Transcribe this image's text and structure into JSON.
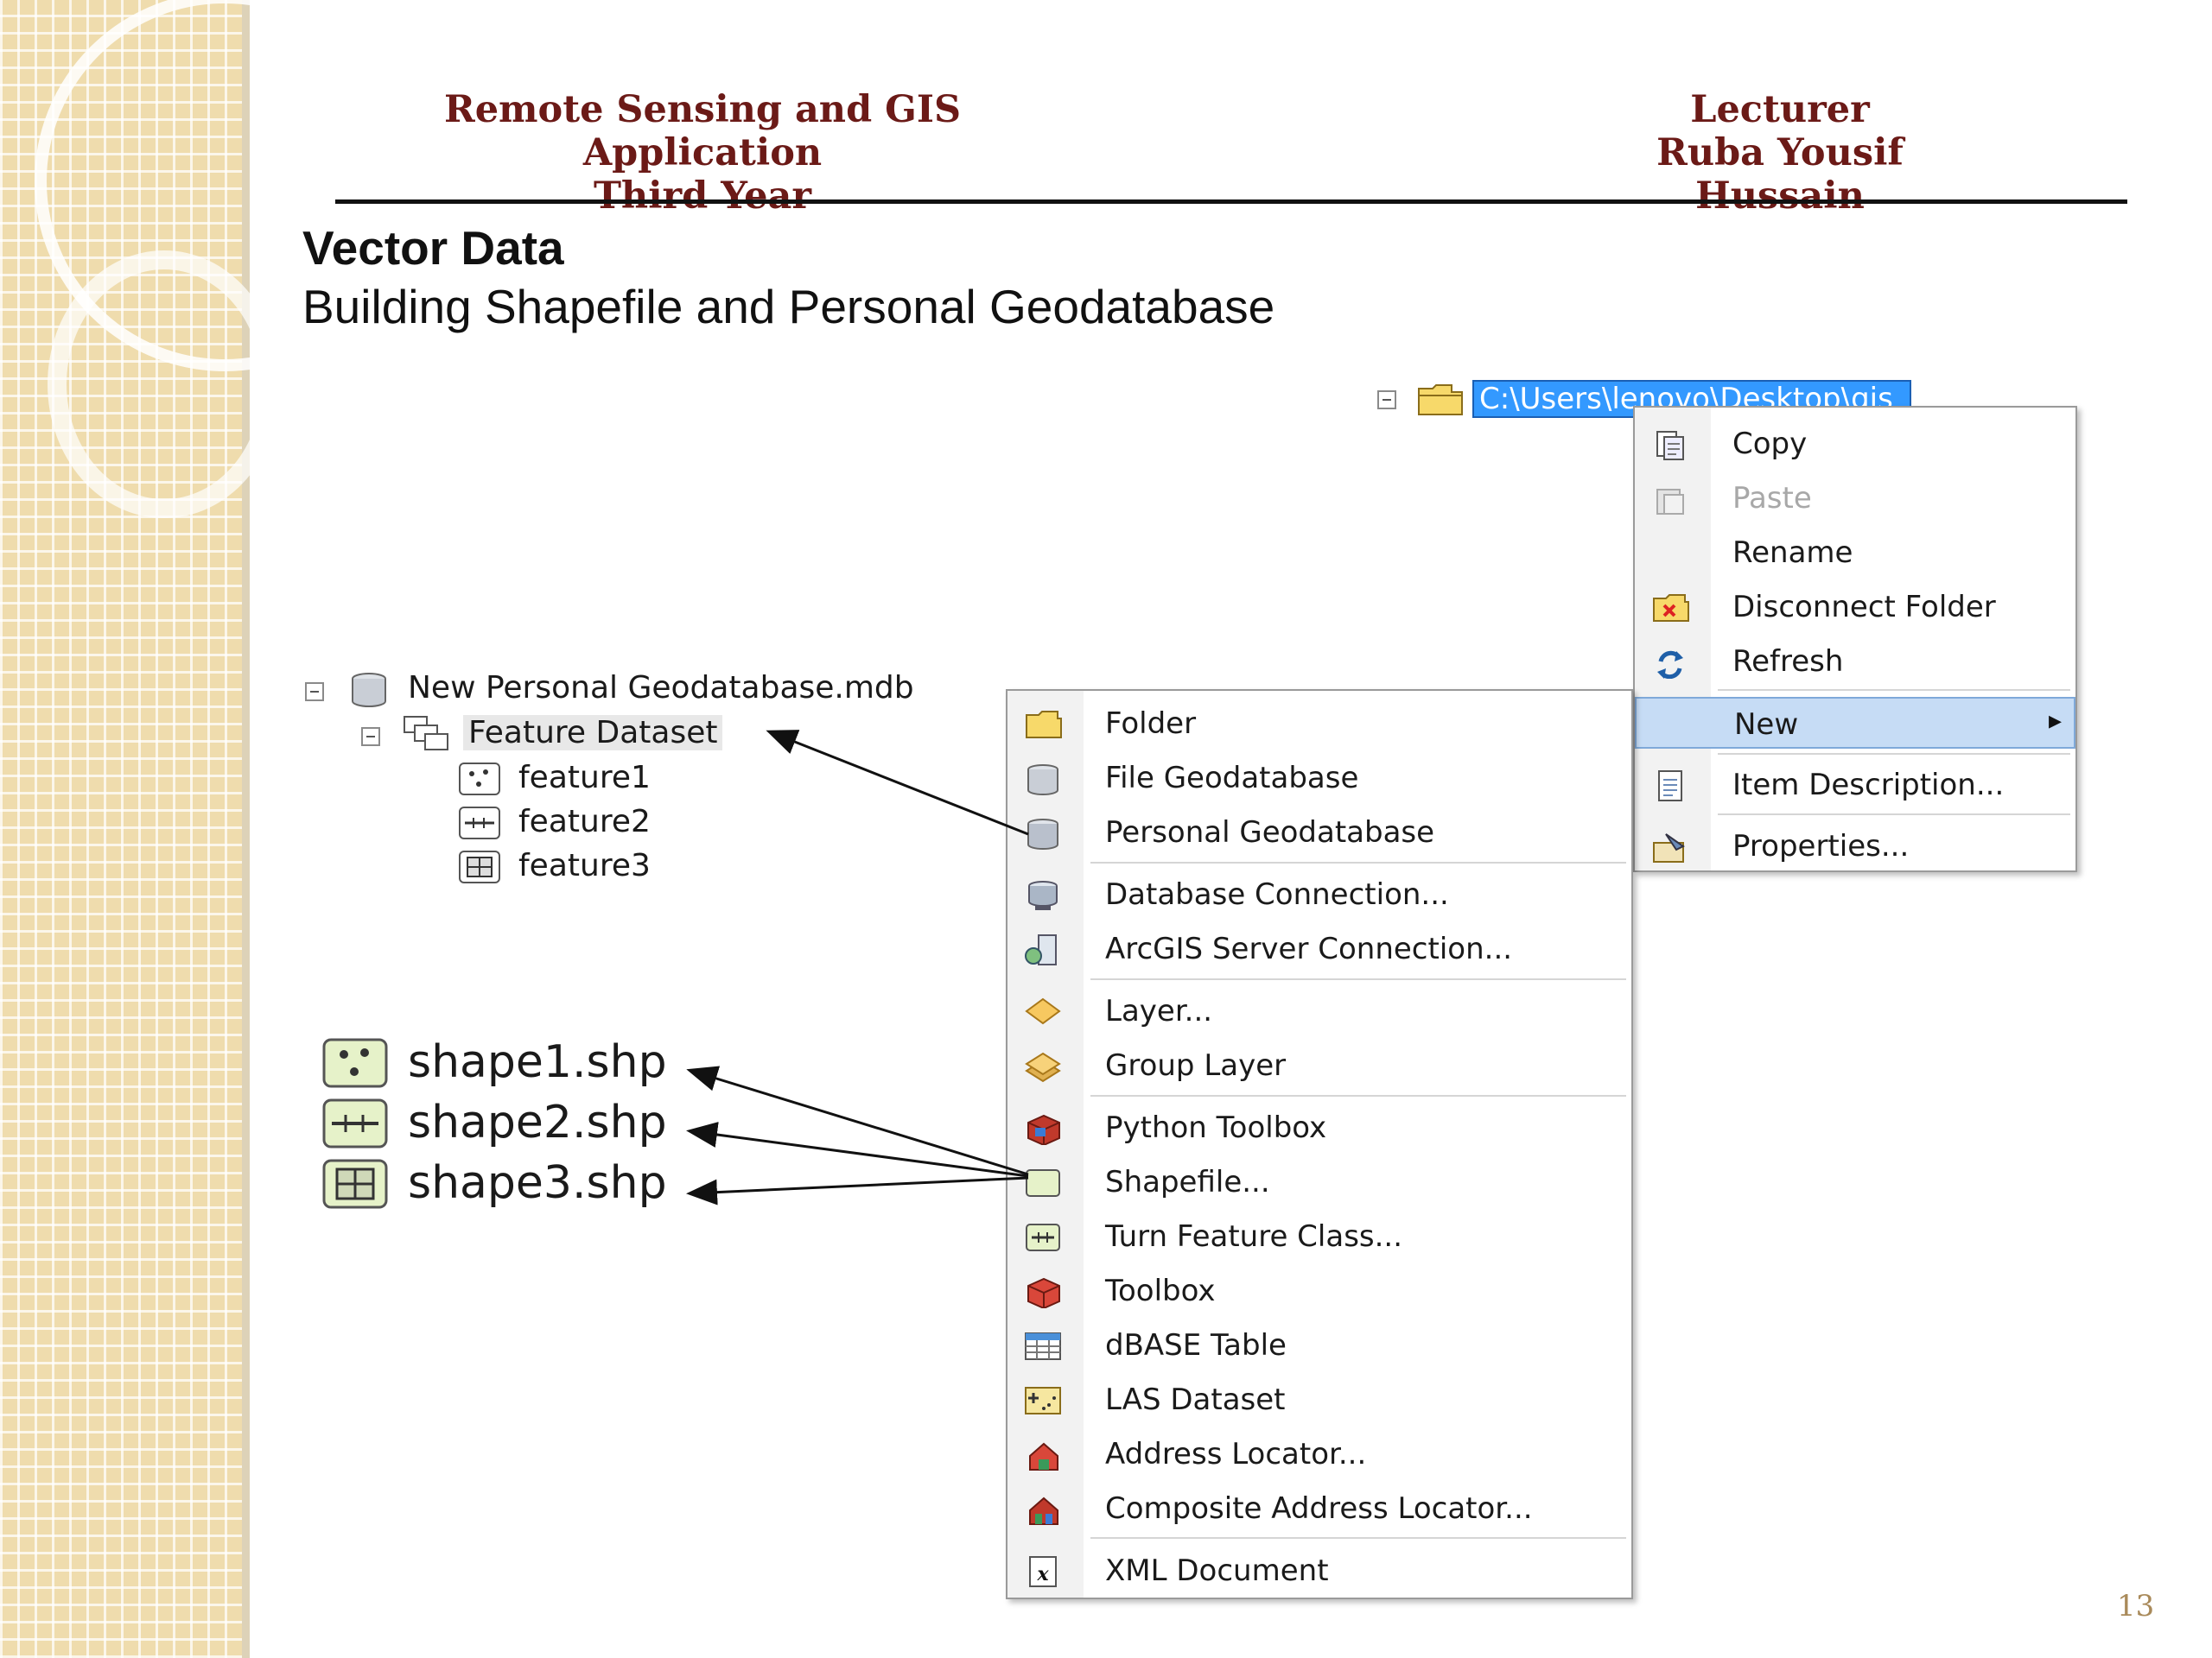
{
  "header": {
    "course_line1": "Remote Sensing and GIS Application",
    "course_line2": "Third Year",
    "lecturer_label": "Lecturer",
    "lecturer_name": "Ruba Yousif Hussain"
  },
  "slide": {
    "title": "Vector Data",
    "subtitle": "Building Shapefile and Personal Geodatabase",
    "page_number": "13"
  },
  "geodatabase_tree": {
    "root": "New Personal Geodatabase.mdb",
    "dataset": "Feature Dataset",
    "features": [
      "feature1",
      "feature2",
      "feature3"
    ]
  },
  "shapefiles": [
    "shape1.shp",
    "shape2.shp",
    "shape3.shp"
  ],
  "folder_path": "C:\\Users\\lenovo\\Desktop\\gis",
  "context_menu": {
    "items": [
      {
        "label": "Copy",
        "icon": "copy-icon"
      },
      {
        "label": "Paste",
        "icon": "paste-icon",
        "disabled": true
      },
      {
        "label": "Rename",
        "icon": ""
      },
      {
        "label": "Disconnect Folder",
        "icon": "disconnect-folder-icon"
      },
      {
        "label": "Refresh",
        "icon": "refresh-icon"
      },
      {
        "label": "New",
        "icon": "",
        "highlighted": true,
        "submenu_arrow": "▸"
      },
      {
        "label": "Item Description...",
        "icon": "item-description-icon"
      },
      {
        "label": "Properties...",
        "icon": "properties-icon"
      }
    ]
  },
  "new_submenu": {
    "items": [
      {
        "label": "Folder",
        "icon": "folder-icon"
      },
      {
        "label": "File Geodatabase",
        "icon": "file-geodatabase-icon"
      },
      {
        "label": "Personal Geodatabase",
        "icon": "personal-geodatabase-icon"
      },
      {
        "label": "Database Connection...",
        "icon": "database-connection-icon"
      },
      {
        "label": "ArcGIS Server Connection...",
        "icon": "server-connection-icon"
      },
      {
        "label": "Layer...",
        "icon": "layer-icon"
      },
      {
        "label": "Group Layer",
        "icon": "group-layer-icon"
      },
      {
        "label": "Python Toolbox",
        "icon": "python-toolbox-icon"
      },
      {
        "label": "Shapefile...",
        "icon": "shapefile-icon"
      },
      {
        "label": "Turn Feature Class...",
        "icon": "turn-feature-class-icon"
      },
      {
        "label": "Toolbox",
        "icon": "toolbox-icon"
      },
      {
        "label": "dBASE Table",
        "icon": "dbase-table-icon"
      },
      {
        "label": "LAS Dataset",
        "icon": "las-dataset-icon"
      },
      {
        "label": "Address Locator...",
        "icon": "address-locator-icon"
      },
      {
        "label": "Composite Address Locator...",
        "icon": "composite-address-locator-icon"
      },
      {
        "label": "XML Document",
        "icon": "xml-document-icon"
      }
    ]
  },
  "colors": {
    "header_text": "#6b1a17",
    "selection": "#3399ff",
    "menu_highlight": "#c6dcf5",
    "sidebar": "#efdcad"
  }
}
